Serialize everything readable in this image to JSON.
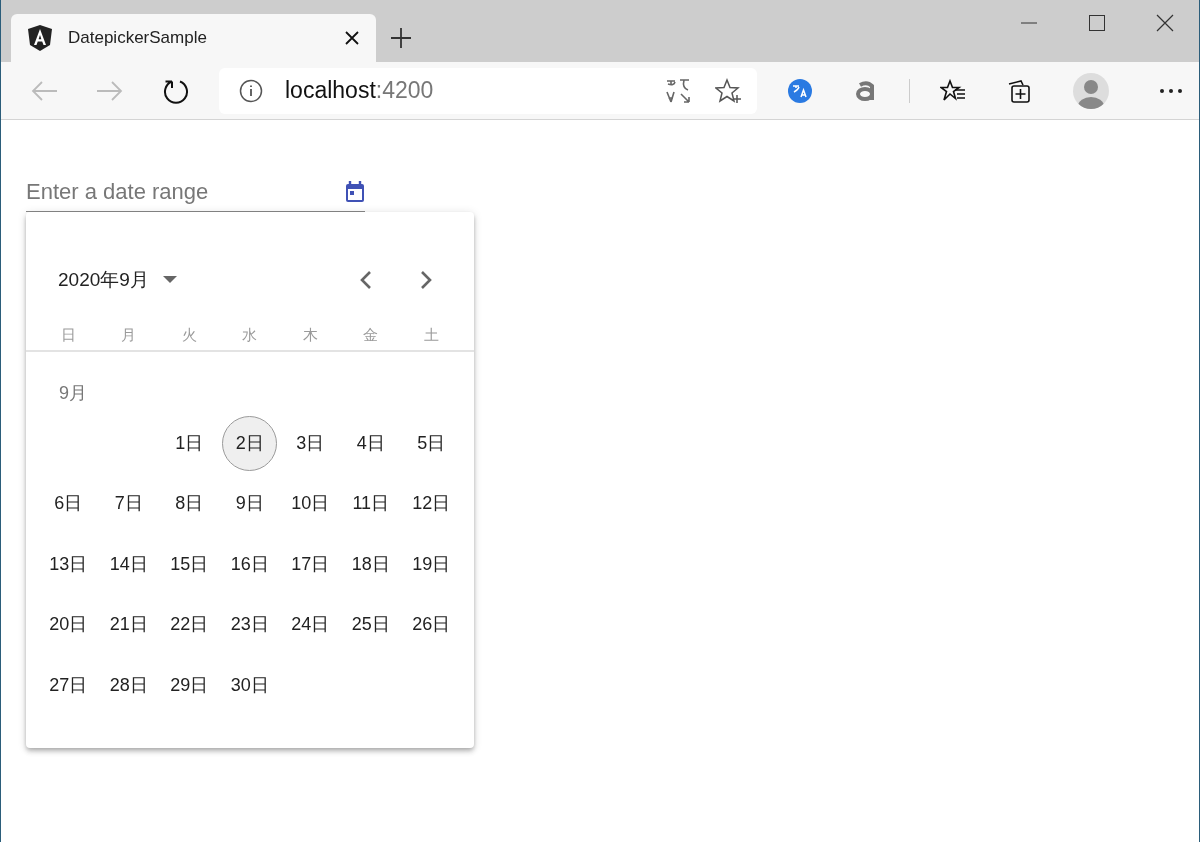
{
  "browser": {
    "tab": {
      "title": "DatepickerSample"
    },
    "address": {
      "host": "localhost",
      "port": ":4200"
    }
  },
  "date_field": {
    "placeholder": "Enter a date range"
  },
  "calendar": {
    "period": "2020年9月",
    "weekdays": [
      "日",
      "月",
      "火",
      "水",
      "木",
      "金",
      "土"
    ],
    "month_label": "9月",
    "weeks": [
      {
        "kind": "first",
        "days": [
          {
            "label": "1日",
            "today": false
          },
          {
            "label": "2日",
            "today": true
          },
          {
            "label": "3日",
            "today": false
          },
          {
            "label": "4日",
            "today": false
          },
          {
            "label": "5日",
            "today": false
          }
        ]
      },
      {
        "kind": "full",
        "days": [
          {
            "label": "6日",
            "today": false
          },
          {
            "label": "7日",
            "today": false
          },
          {
            "label": "8日",
            "today": false
          },
          {
            "label": "9日",
            "today": false
          },
          {
            "label": "10日",
            "today": false
          },
          {
            "label": "11日",
            "today": false
          },
          {
            "label": "12日",
            "today": false
          }
        ]
      },
      {
        "kind": "full",
        "days": [
          {
            "label": "13日",
            "today": false
          },
          {
            "label": "14日",
            "today": false
          },
          {
            "label": "15日",
            "today": false
          },
          {
            "label": "16日",
            "today": false
          },
          {
            "label": "17日",
            "today": false
          },
          {
            "label": "18日",
            "today": false
          },
          {
            "label": "19日",
            "today": false
          }
        ]
      },
      {
        "kind": "full",
        "days": [
          {
            "label": "20日",
            "today": false
          },
          {
            "label": "21日",
            "today": false
          },
          {
            "label": "22日",
            "today": false
          },
          {
            "label": "23日",
            "today": false
          },
          {
            "label": "24日",
            "today": false
          },
          {
            "label": "25日",
            "today": false
          },
          {
            "label": "26日",
            "today": false
          }
        ]
      },
      {
        "kind": "last",
        "days": [
          {
            "label": "27日",
            "today": false
          },
          {
            "label": "28日",
            "today": false
          },
          {
            "label": "29日",
            "today": false
          },
          {
            "label": "30日",
            "today": false
          }
        ]
      }
    ]
  }
}
